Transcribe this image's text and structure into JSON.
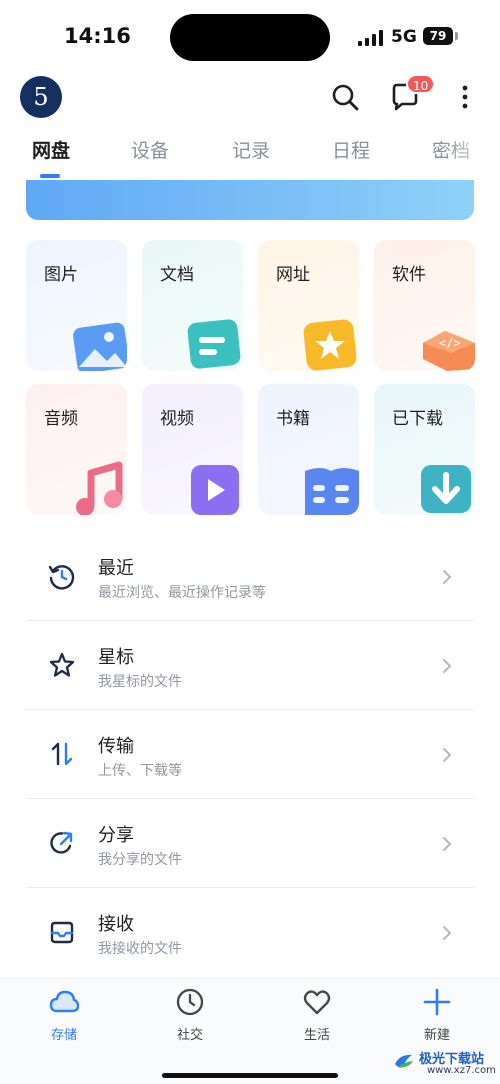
{
  "status_bar": {
    "time": "14:16",
    "network": "5G",
    "battery": "79"
  },
  "header": {
    "avatar_text": "5",
    "message_badge": "10"
  },
  "tabs": [
    {
      "label": "网盘",
      "active": true
    },
    {
      "label": "设备",
      "active": false
    },
    {
      "label": "记录",
      "active": false
    },
    {
      "label": "日程",
      "active": false
    },
    {
      "label": "密档",
      "active": false
    }
  ],
  "categories": [
    {
      "label": "图片",
      "icon": "image-icon"
    },
    {
      "label": "文档",
      "icon": "document-icon"
    },
    {
      "label": "网址",
      "icon": "star-bookmark-icon"
    },
    {
      "label": "软件",
      "icon": "software-icon"
    },
    {
      "label": "音频",
      "icon": "music-icon"
    },
    {
      "label": "视频",
      "icon": "video-icon"
    },
    {
      "label": "书籍",
      "icon": "book-icon"
    },
    {
      "label": "已下载",
      "icon": "download-icon"
    }
  ],
  "list": [
    {
      "title": "最近",
      "subtitle": "最近浏览、最近操作记录等",
      "icon": "clock-history-icon"
    },
    {
      "title": "星标",
      "subtitle": "我星标的文件",
      "icon": "star-icon"
    },
    {
      "title": "传输",
      "subtitle": "上传、下载等",
      "icon": "transfer-icon"
    },
    {
      "title": "分享",
      "subtitle": "我分享的文件",
      "icon": "share-icon"
    },
    {
      "title": "接收",
      "subtitle": "我接收的文件",
      "icon": "inbox-icon"
    }
  ],
  "bottom_nav": [
    {
      "label": "存储",
      "icon": "cloud-icon",
      "active": true
    },
    {
      "label": "社交",
      "icon": "clock-icon",
      "active": false
    },
    {
      "label": "生活",
      "icon": "heart-icon",
      "active": false
    },
    {
      "label": "新建",
      "icon": "plus-icon",
      "active": false
    }
  ],
  "watermark": {
    "title": "极光下载站",
    "url": "www.xz7.com"
  },
  "colors": {
    "accent": "#2f7df6",
    "badge": "#f05a5a",
    "avatar_bg": "#14305f"
  }
}
